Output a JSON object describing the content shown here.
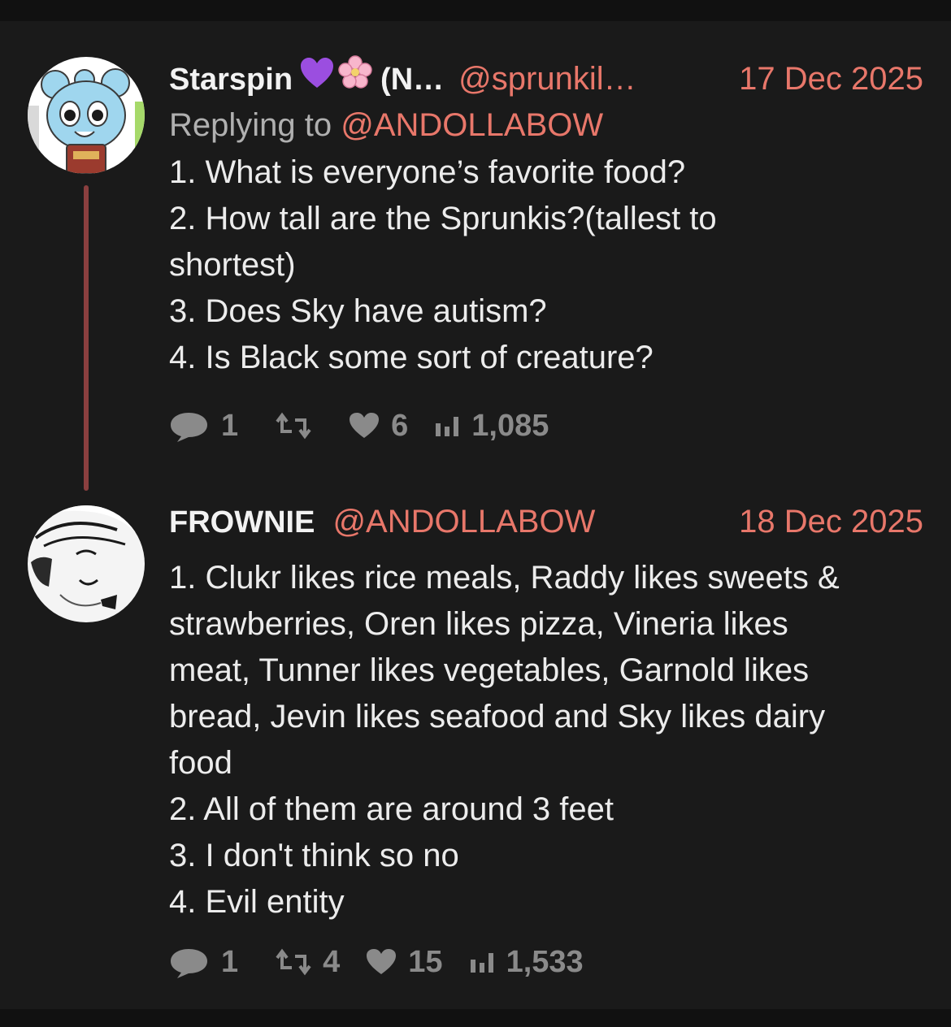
{
  "tweets": [
    {
      "name": "Starspin",
      "name_suffix": "(N…",
      "handle": "@sprunkil…",
      "date": "17 Dec 2025",
      "replying_prefix": "Replying to",
      "replying_to": "@ANDOLLABOW",
      "lines": [
        "1. What is everyone’s favorite food?",
        "2. How tall are the Sprunkis?(tallest to",
        "shortest)",
        "3. Does Sky have autism?",
        "4. Is Black some sort of creature?"
      ],
      "stats": {
        "replies": "1",
        "reposts": "",
        "likes": "6",
        "views": "1,085"
      }
    },
    {
      "name": "FROWNIE",
      "handle": "@ANDOLLABOW",
      "date": "18 Dec 2025",
      "lines": [
        "1. Clukr likes rice meals, Raddy likes sweets &",
        "strawberries, Oren likes pizza, Vineria likes",
        "meat, Tunner likes vegetables, Garnold likes",
        "bread, Jevin likes seafood and Sky likes dairy",
        "food",
        "2. All of them are around 3 feet",
        "3. I don't think so no",
        "4. Evil entity"
      ],
      "stats": {
        "replies": "1",
        "reposts": "4",
        "likes": "15",
        "views": "1,533"
      }
    }
  ],
  "icons": {
    "purple_heart": "purple-heart-emoji",
    "cherry_blossom": "cherry-blossom-emoji",
    "reply": "reply-icon",
    "repost": "repost-icon",
    "like": "heart-icon",
    "views": "views-icon"
  },
  "colors": {
    "background": "#1a1a1a",
    "accent": "#e8776a",
    "thread_line": "#8a3f3f",
    "muted": "#8a8a8a"
  }
}
